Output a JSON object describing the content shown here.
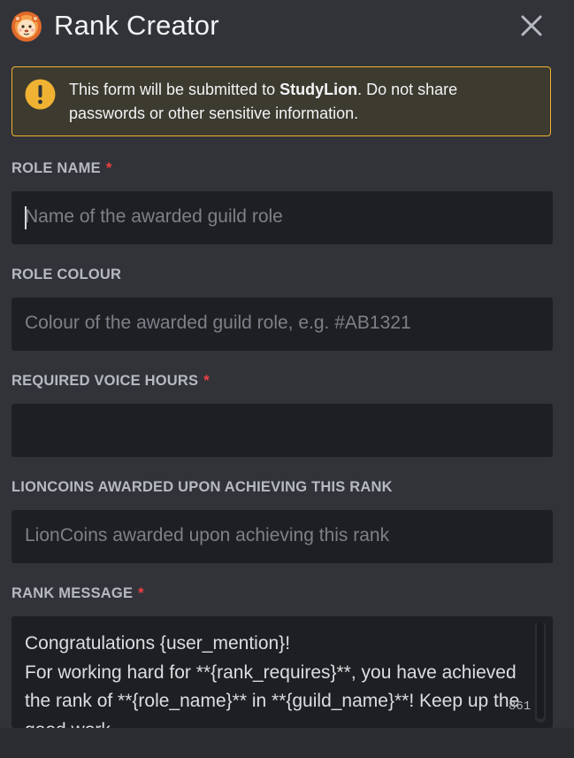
{
  "header": {
    "title": "Rank Creator",
    "avatar_icon": "lion-avatar-icon",
    "close_icon": "close-icon"
  },
  "warning": {
    "text_before": "This form will be submitted to ",
    "app_name": "StudyLion",
    "text_after": ". Do not share passwords or other sensitive information.",
    "icon": "exclamation-icon",
    "border_color": "#f0b232"
  },
  "fields": {
    "role_name": {
      "label": "ROLE NAME",
      "required_mark": "*",
      "placeholder": "Name of the awarded guild role",
      "value": ""
    },
    "role_colour": {
      "label": "ROLE COLOUR",
      "placeholder": "Colour of the awarded guild role, e.g. #AB1321",
      "value": ""
    },
    "voice_hours": {
      "label": "REQUIRED VOICE HOURS",
      "required_mark": "*",
      "placeholder": "",
      "value": ""
    },
    "lioncoins": {
      "label": "LIONCOINS AWARDED UPON ACHIEVING THIS RANK",
      "placeholder": "LionCoins awarded upon achieving this rank",
      "value": ""
    },
    "rank_message": {
      "label": "RANK MESSAGE",
      "required_mark": "*",
      "value": "Congratulations {user_mention}!\nFor working hard for **{rank_requires}**, you have achieved the rank of **{role_name}** in **{guild_name}**! Keep up the good work.",
      "char_count": "861"
    }
  },
  "colors": {
    "background": "#313338",
    "input_background": "#1e1f22",
    "required": "#f23f43",
    "warning_icon": "#f0b232"
  }
}
